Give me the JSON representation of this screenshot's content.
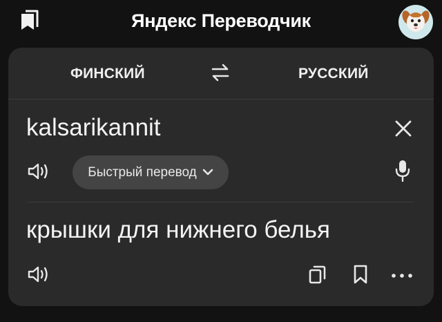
{
  "header": {
    "title": "Яндекс Переводчик",
    "bookmarks_icon": "bookmarks-icon",
    "avatar_icon": "dog-avatar-icon"
  },
  "languages": {
    "source": "ФИНСКИЙ",
    "target": "РУССКИЙ",
    "swap_icon": "swap-arrows-icon"
  },
  "input": {
    "text": "kalsarikannit",
    "clear_icon": "close-icon",
    "speaker_icon": "speaker-icon",
    "mic_icon": "microphone-icon",
    "quick_translate_label": "Быстрый перевод",
    "quick_translate_icon": "chevron-down-icon"
  },
  "output": {
    "text": "крышки для нижнего белья",
    "speaker_icon": "speaker-icon",
    "copy_icon": "copy-icon",
    "save_icon": "bookmark-icon",
    "more_icon": "more-dots-icon"
  },
  "colors": {
    "background": "#121212",
    "card": "#2a2a2a",
    "pill": "#444444",
    "text": "#f2f2f2"
  }
}
